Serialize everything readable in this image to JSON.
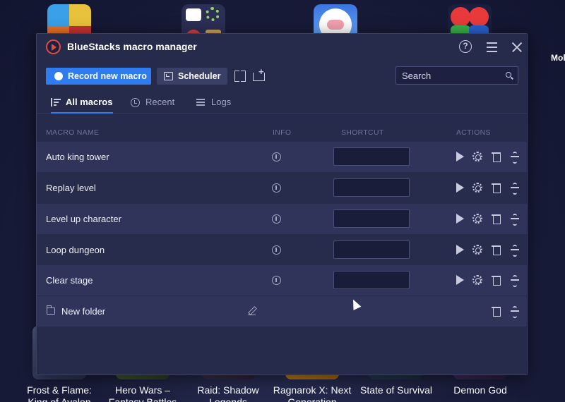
{
  "window": {
    "title": "BlueStacks macro manager"
  },
  "toolbar": {
    "record_label": "Record new macro",
    "scheduler_label": "Scheduler",
    "search_placeholder": "Search"
  },
  "tabs": [
    {
      "label": "All macros",
      "active": true
    },
    {
      "label": "Recent",
      "active": false
    },
    {
      "label": "Logs",
      "active": false
    }
  ],
  "table": {
    "headers": {
      "name": "MACRO NAME",
      "info": "INFO",
      "shortcut": "SHORTCUT",
      "actions": "ACTIONS"
    },
    "macros": [
      {
        "name": "Auto king tower",
        "shortcut": ""
      },
      {
        "name": "Replay level",
        "shortcut": ""
      },
      {
        "name": "Level up character",
        "shortcut": ""
      },
      {
        "name": "Loop dungeon",
        "shortcut": ""
      },
      {
        "name": "Clear stage",
        "shortcut": ""
      }
    ],
    "folders": [
      {
        "name": "New folder"
      }
    ]
  },
  "desktop": {
    "partial_label": "Mol",
    "games": [
      {
        "line1": "Frost & Flame:",
        "line2": "King of Avalon"
      },
      {
        "line1": "Hero Wars –",
        "line2": "Fantasy Battles"
      },
      {
        "line1": "Raid: Shadow",
        "line2": "Legends"
      },
      {
        "line1": "Ragnarok X: Next",
        "line2": "Generation"
      },
      {
        "line1": "State of Survival",
        "line2": ""
      },
      {
        "line1": "Demon God",
        "line2": ""
      }
    ]
  },
  "colors": {
    "accent": "#2f7cf0",
    "window_bg": "#262a4b",
    "row_alt": "#30345a",
    "logo_red": "#e84b3a"
  }
}
